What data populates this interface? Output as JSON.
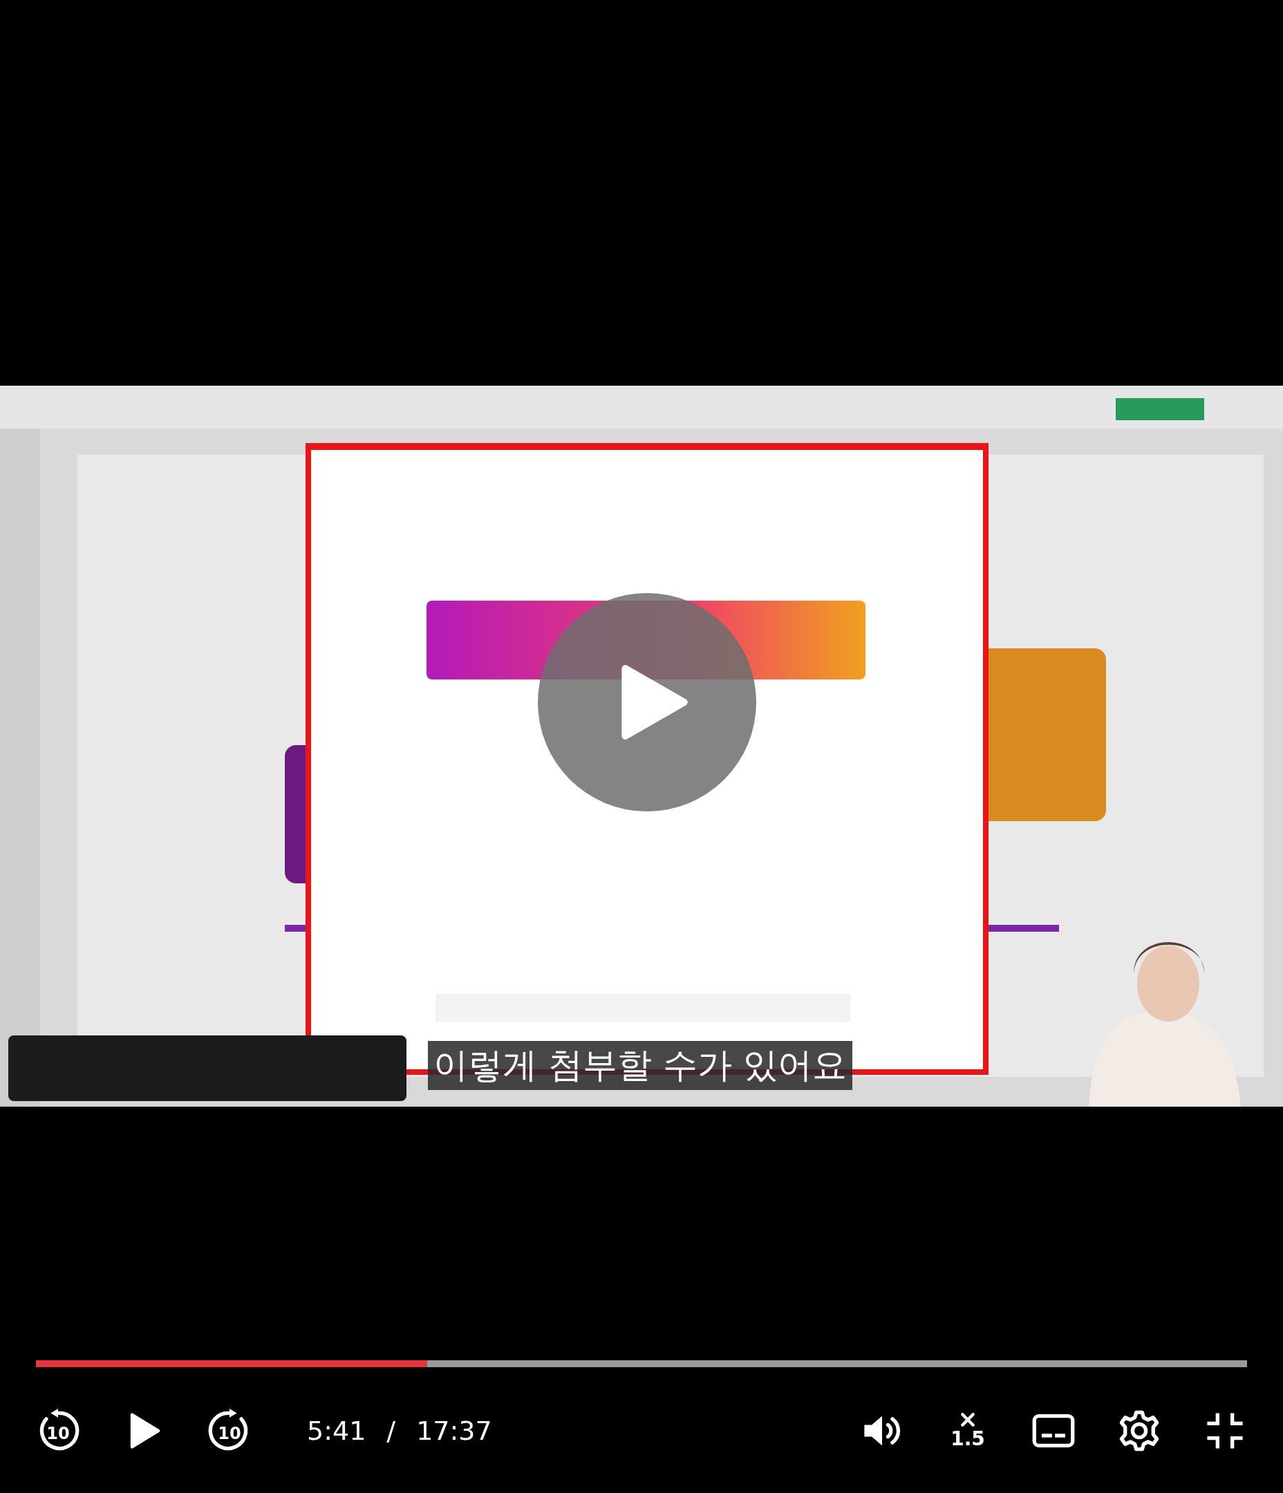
{
  "video": {
    "kind": "picture",
    "paused": true,
    "subtitle": "이렇게 첨부할 수가 있어요"
  },
  "progress": {
    "level": 0.323
  },
  "controls": {
    "rewind_seconds": "10",
    "forward_seconds": "10",
    "current_time": "5:41",
    "separator": "/",
    "duration": "17:37",
    "speed": "1.5"
  }
}
